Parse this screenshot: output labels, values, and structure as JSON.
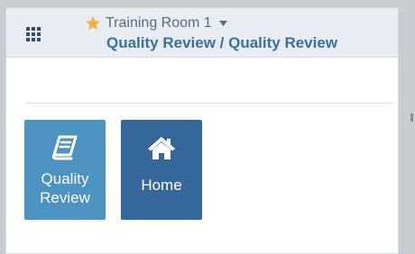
{
  "header": {
    "workspace": {
      "name": "Training Room 1",
      "favorite_icon": "star-icon",
      "dropdown_icon": "caret-down-icon"
    },
    "breadcrumb": "Quality Review / Quality Review",
    "menu_icon": "apps-grid-icon"
  },
  "tiles": [
    {
      "label": "Quality Review",
      "icon": "book-icon",
      "color": "#4d93c2"
    },
    {
      "label": "Home",
      "icon": "home-icon",
      "color": "#35679b"
    }
  ],
  "colors": {
    "header_bg": "#e8edf3",
    "accent_text": "#3a6fa0",
    "star": "#f2b33d"
  }
}
